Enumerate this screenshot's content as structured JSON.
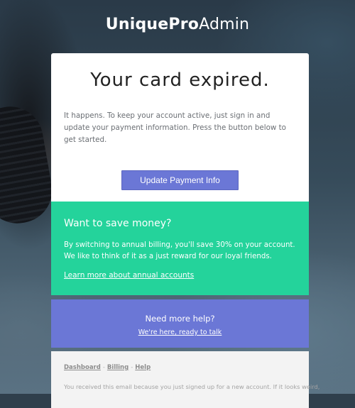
{
  "brand": {
    "logo_bold": "UniquePro",
    "logo_light": "Admin"
  },
  "main": {
    "headline": "Your card expired.",
    "body": "It happens. To keep your account active, just sign in and update your payment information. Press the button below to get started.",
    "button_label": "Update Payment Info"
  },
  "savings": {
    "title": "Want to save money?",
    "body": "By switching to annual billing, you'll save 30% on your account. We like to think of it as a just reward for our loyal friends.",
    "link": "Learn more about annual accounts"
  },
  "help": {
    "title": "Need more help?",
    "link": "We're here, ready to talk"
  },
  "footer": {
    "nav": [
      "Dashboard",
      "Billing",
      "Help"
    ],
    "separator": "-",
    "note": "You received this email because you just signed up for a new account. If it looks weird,"
  },
  "colors": {
    "accent": "#6b77d6",
    "success": "#24d39b",
    "footer_bg": "#f3f3f3"
  }
}
